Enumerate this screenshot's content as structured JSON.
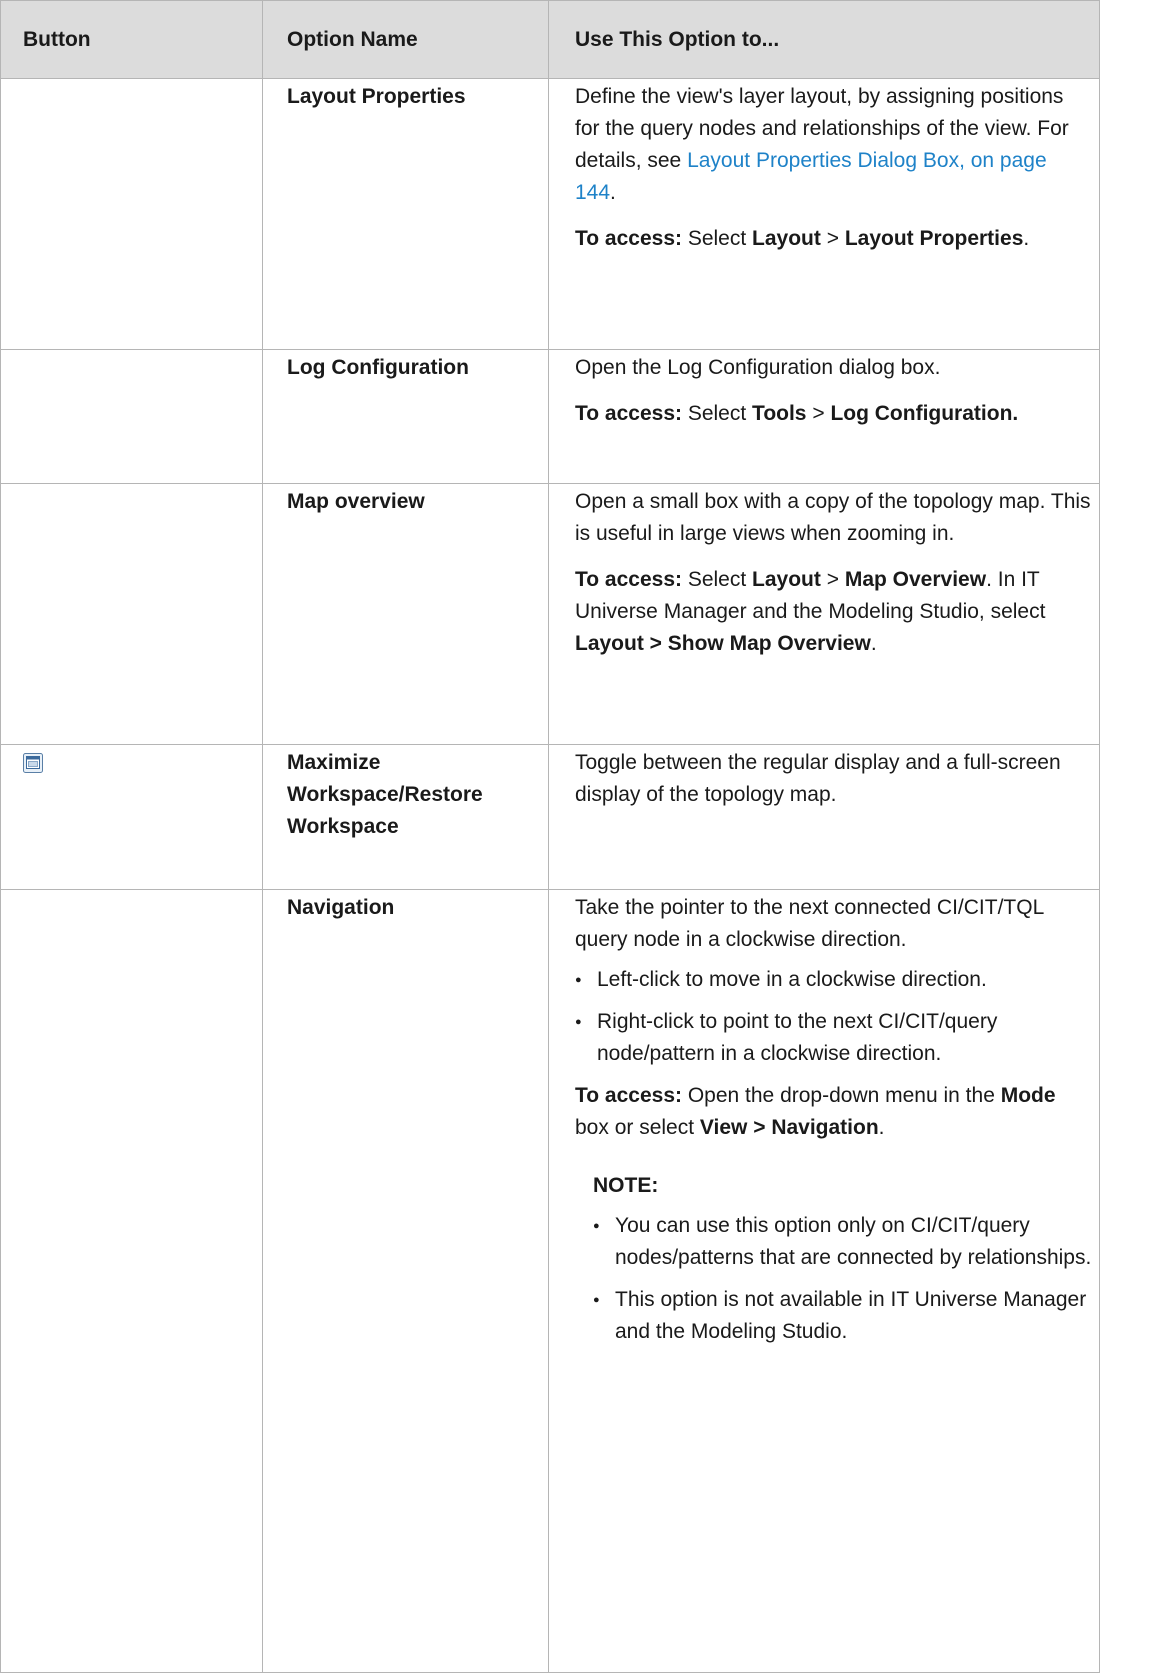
{
  "table": {
    "headers": [
      "Button",
      "Option Name",
      "Use This Option to..."
    ],
    "rows": [
      {
        "button_icon": "",
        "option": "Layout Properties",
        "desc_pre": "Define the view's layer layout, by assigning positions for the query nodes and relationships of the view. For details, see ",
        "desc_link": "Layout Properties Dialog Box, on page 144",
        "desc_post": ".",
        "access_label": "To access:",
        "access_text_1": " Select ",
        "access_bold_1": "Layout",
        "access_text_2": " > ",
        "access_bold_2": "Layout Properties",
        "access_text_3": "."
      },
      {
        "button_icon": "",
        "option": "Log Configuration",
        "desc": "Open the Log Configuration dialog box.",
        "access_label": "To access:",
        "access_text_1": " Select ",
        "access_bold_1": "Tools",
        "access_text_2": " > ",
        "access_bold_2": "Log Configuration."
      },
      {
        "button_icon": "",
        "option": "Map overview",
        "desc": "Open a small box with a copy of the topology map. This is useful in large views when zooming in.",
        "access_label": "To access:",
        "access_text_1": " Select ",
        "access_bold_1": "Layout",
        "access_text_2": " > ",
        "access_bold_2": "Map Overview",
        "access_text_3": ". In IT Universe Manager and the Modeling Studio, select ",
        "access_bold_3": "Layout > Show Map Overview",
        "access_text_4": "."
      },
      {
        "button_icon": "maximize-workspace-icon",
        "option": "Maximize Workspace/Restore Workspace",
        "desc": "Toggle between the regular display and a full-screen display of the topology map."
      },
      {
        "button_icon": "",
        "option": "Navigation",
        "desc": "Take the pointer to the next connected CI/CIT/TQL query node in a clockwise direction.",
        "bullets": [
          "Left-click to move in a clockwise direction.",
          "Right-click to point to the next CI/CIT/query node/pattern in a clockwise direction."
        ],
        "access_label": "To access:",
        "access_text_1": " Open the drop-down menu in the ",
        "access_bold_1": "Mode",
        "access_text_2": " box or select ",
        "access_bold_2": "View > Navigation",
        "access_text_3": ".",
        "note_label": "NOTE:",
        "notes": [
          "You can use this option only on CI/CIT/query nodes/patterns that are connected by relationships.",
          "This option is not available in IT Universe Manager and the Modeling Studio."
        ]
      }
    ]
  },
  "colors": {
    "header_bg": "#dcdcdc",
    "border": "#b5b5b5",
    "link": "#1e82c8"
  }
}
